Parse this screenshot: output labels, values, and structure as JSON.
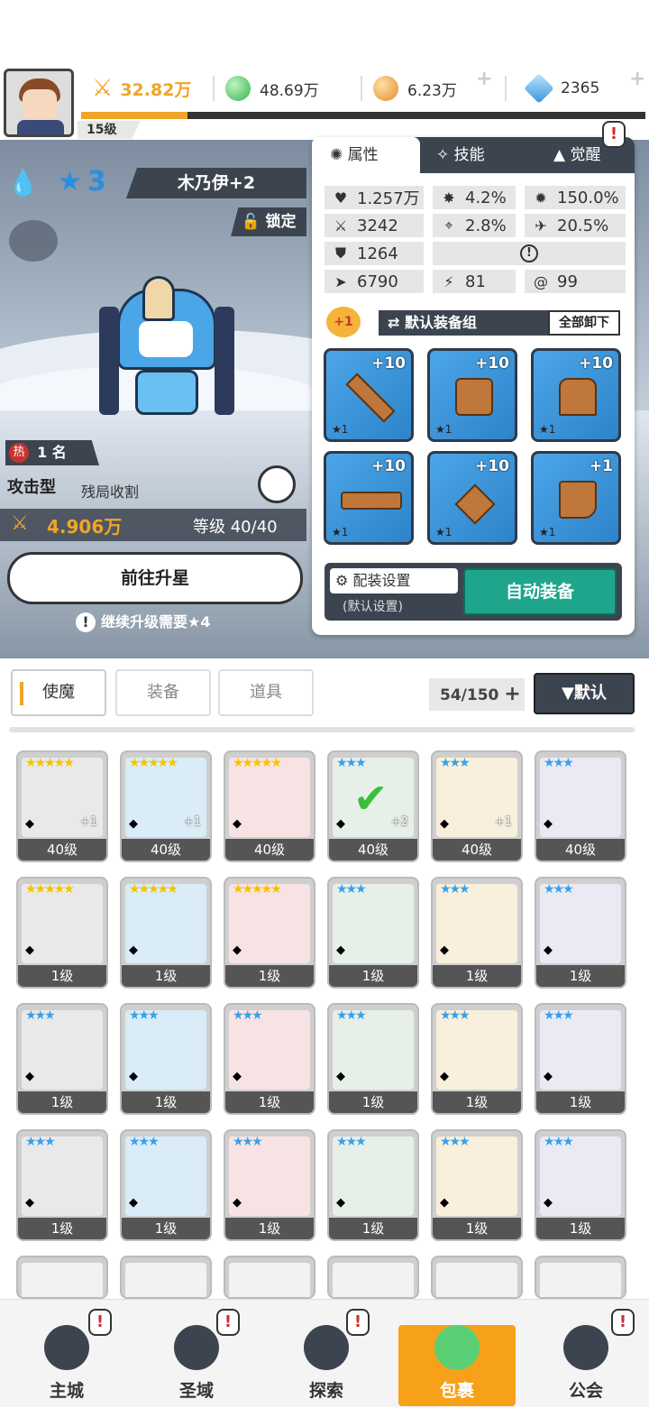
{
  "topbar": {
    "power": "32.82万",
    "gems": "48.69万",
    "gold": "6.23万",
    "diamond": "2365",
    "level": "15级",
    "colors": {
      "power": "#f0a528",
      "gem": "#5ed36a",
      "gold": "#f5a94a",
      "diamond": "#6fb9ec"
    }
  },
  "hero": {
    "stars": "3",
    "name": "木乃伊+2",
    "lock": "锁定",
    "rank": "1 名",
    "rank_icon": "热",
    "type": "攻击型",
    "subtype": "残局收割",
    "power": "4.906万",
    "level": "等级 40/40",
    "upgrade_btn": "前往升星",
    "upgrade_hint": "继续升级需要★4"
  },
  "panel": {
    "tabs": [
      "属性",
      "技能",
      "觉醒"
    ],
    "stats": {
      "hp": "1.257万",
      "crit": "4.2%",
      "critdmg": "150.0%",
      "atk": "3242",
      "hit": "2.8%",
      "dodge": "20.5%",
      "def": "1264",
      "speed": "6790",
      "s1": "81",
      "s2": "99"
    },
    "equip_group_badge": "+1",
    "equip_group": "默认装备组",
    "unequip_all": "全部卸下",
    "equipment": [
      {
        "lv": "+10",
        "star": "★1",
        "icon": "sword-icon"
      },
      {
        "lv": "+10",
        "star": "★1",
        "icon": "helmet-icon"
      },
      {
        "lv": "+10",
        "star": "★1",
        "icon": "armor-icon"
      },
      {
        "lv": "+10",
        "star": "★1",
        "icon": "belt-icon"
      },
      {
        "lv": "+10",
        "star": "★1",
        "icon": "necklace-icon"
      },
      {
        "lv": "+1",
        "star": "★1",
        "icon": "boots-icon"
      }
    ],
    "config_label": "配装设置",
    "config_sub": "(默认设置)",
    "auto_equip": "自动装备"
  },
  "list": {
    "categories": [
      "使魔",
      "装备",
      "道具"
    ],
    "count": "54/150",
    "sort": "▼默认",
    "cards": [
      {
        "stars": "★★★★★",
        "lv": "40级",
        "plus": "+1",
        "color": "#f6c200"
      },
      {
        "stars": "★★★★★",
        "lv": "40级",
        "plus": "+1",
        "color": "#f6c200"
      },
      {
        "stars": "★★★★★",
        "lv": "40级",
        "plus": "",
        "color": "#f6c200"
      },
      {
        "stars": "★★★",
        "lv": "40级",
        "plus": "+2",
        "color": "#3aa0e8"
      },
      {
        "stars": "★★★",
        "lv": "40级",
        "plus": "+1",
        "color": "#3aa0e8"
      },
      {
        "stars": "★★★",
        "lv": "40级",
        "plus": "",
        "color": "#3aa0e8"
      },
      {
        "stars": "★★★★★",
        "lv": "1级",
        "plus": "",
        "color": "#f6c200"
      },
      {
        "stars": "★★★★★",
        "lv": "1级",
        "plus": "",
        "color": "#f6c200"
      },
      {
        "stars": "★★★★★",
        "lv": "1级",
        "plus": "",
        "color": "#f6c200"
      },
      {
        "stars": "★★★",
        "lv": "1级",
        "plus": "",
        "color": "#3aa0e8"
      },
      {
        "stars": "★★★",
        "lv": "1级",
        "plus": "",
        "color": "#3aa0e8"
      },
      {
        "stars": "★★★",
        "lv": "1级",
        "plus": "",
        "color": "#3aa0e8"
      },
      {
        "stars": "★★★",
        "lv": "1级",
        "plus": "",
        "color": "#3aa0e8"
      },
      {
        "stars": "★★★",
        "lv": "1级",
        "plus": "",
        "color": "#3aa0e8"
      },
      {
        "stars": "★★★",
        "lv": "1级",
        "plus": "",
        "color": "#3aa0e8"
      },
      {
        "stars": "★★★",
        "lv": "1级",
        "plus": "",
        "color": "#3aa0e8"
      },
      {
        "stars": "★★★",
        "lv": "1级",
        "plus": "",
        "color": "#3aa0e8"
      },
      {
        "stars": "★★★",
        "lv": "1级",
        "plus": "",
        "color": "#3aa0e8"
      },
      {
        "stars": "★★★",
        "lv": "1级",
        "plus": "",
        "color": "#3aa0e8"
      },
      {
        "stars": "★★★",
        "lv": "1级",
        "plus": "",
        "color": "#3aa0e8"
      },
      {
        "stars": "★★★",
        "lv": "1级",
        "plus": "",
        "color": "#3aa0e8"
      },
      {
        "stars": "★★★",
        "lv": "1级",
        "plus": "",
        "color": "#3aa0e8"
      },
      {
        "stars": "★★★",
        "lv": "1级",
        "plus": "",
        "color": "#3aa0e8"
      },
      {
        "stars": "★★★",
        "lv": "1级",
        "plus": "",
        "color": "#3aa0e8"
      }
    ]
  },
  "nav": [
    "主城",
    "圣域",
    "探索",
    "包裹",
    "公会"
  ],
  "alert_mark": "!"
}
